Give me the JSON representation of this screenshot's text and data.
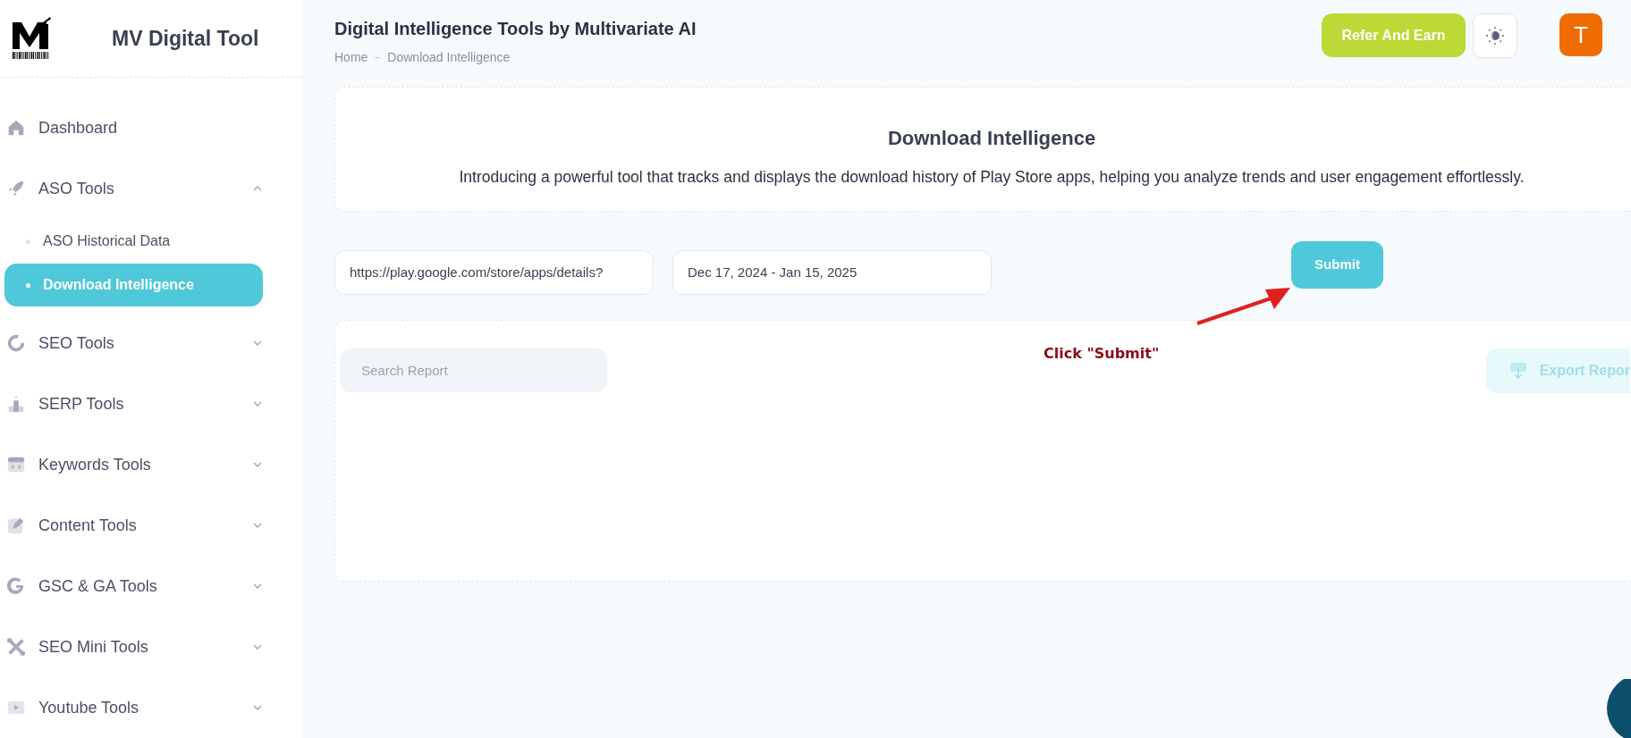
{
  "sidebar": {
    "brand": "MV Digital Tool",
    "items": [
      {
        "kind": "link",
        "label": "Dashboard"
      },
      {
        "kind": "group",
        "label": "ASO Tools",
        "expanded": true,
        "children": [
          {
            "label": "ASO Historical Data",
            "selected": false
          },
          {
            "label": "Download Intelligence",
            "selected": true
          }
        ]
      },
      {
        "kind": "group",
        "label": "SEO Tools",
        "expanded": false
      },
      {
        "kind": "group",
        "label": "SERP Tools",
        "expanded": false
      },
      {
        "kind": "group",
        "label": "Keywords Tools",
        "expanded": false
      },
      {
        "kind": "group",
        "label": "Content Tools",
        "expanded": false
      },
      {
        "kind": "group",
        "label": "GSC & GA Tools",
        "expanded": false
      },
      {
        "kind": "group",
        "label": "SEO Mini Tools",
        "expanded": false
      },
      {
        "kind": "group",
        "label": "Youtube Tools",
        "expanded": false
      }
    ]
  },
  "header": {
    "title": "Digital Intelligence Tools by Multivariate AI",
    "breadcrumb": [
      "Home",
      "Download Intelligence"
    ],
    "refer_button": "Refer And Earn",
    "avatar": "T"
  },
  "intro": {
    "title": "Download Intelligence",
    "description": "Introducing a powerful tool that tracks and displays the download history of Play Store apps, helping you analyze trends and user engagement effortlessly."
  },
  "form": {
    "url_field": "https://play.google.com/store/apps/details?",
    "date_field": "Dec 17, 2024 - Jan 15, 2025",
    "submit": "Submit",
    "annotation": "Click \"Submit\""
  },
  "report": {
    "search": {
      "placeholder": "Search Report"
    },
    "export_button": "Export Repor"
  }
}
